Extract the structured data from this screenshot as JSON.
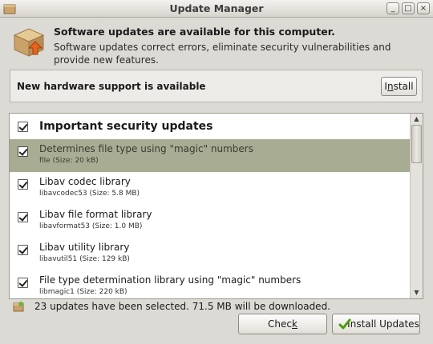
{
  "window": {
    "title": "Update Manager",
    "controls": [
      "minimize-icon",
      "maximize-icon",
      "close-icon"
    ]
  },
  "header": {
    "title": "Software updates are available for this computer.",
    "description": "Software updates correct errors, eliminate security vulnerabilities and provide new features."
  },
  "hardware_banner": {
    "text": "New hardware support is available",
    "button_label_prefix": "I",
    "button_label_underlined": "n",
    "button_label_suffix": "stall"
  },
  "updates": {
    "group_label": "Important security updates",
    "items": [
      {
        "name": "Determines file type using \"magic\" numbers",
        "package": "file (Size: 20 kB)",
        "selected": true
      },
      {
        "name": "Libav codec library",
        "package": "libavcodec53 (Size: 5.8 MB)",
        "selected": false
      },
      {
        "name": "Libav file format library",
        "package": "libavformat53 (Size: 1.0 MB)",
        "selected": false
      },
      {
        "name": "Libav utility library",
        "package": "libavutil51 (Size: 129 kB)",
        "selected": false
      },
      {
        "name": "File type determination library using \"magic\" numbers",
        "package": "libmagic1 (Size: 220 kB)",
        "selected": false
      }
    ]
  },
  "status": {
    "text": "23 updates have been selected. 71.5 MB will be downloaded."
  },
  "buttons": {
    "check_prefix": "Chec",
    "check_underlined": "k",
    "install_updates": "Install Updates"
  },
  "colors": {
    "selection": "#a7ac93",
    "window_bg": "#dcdad5"
  }
}
